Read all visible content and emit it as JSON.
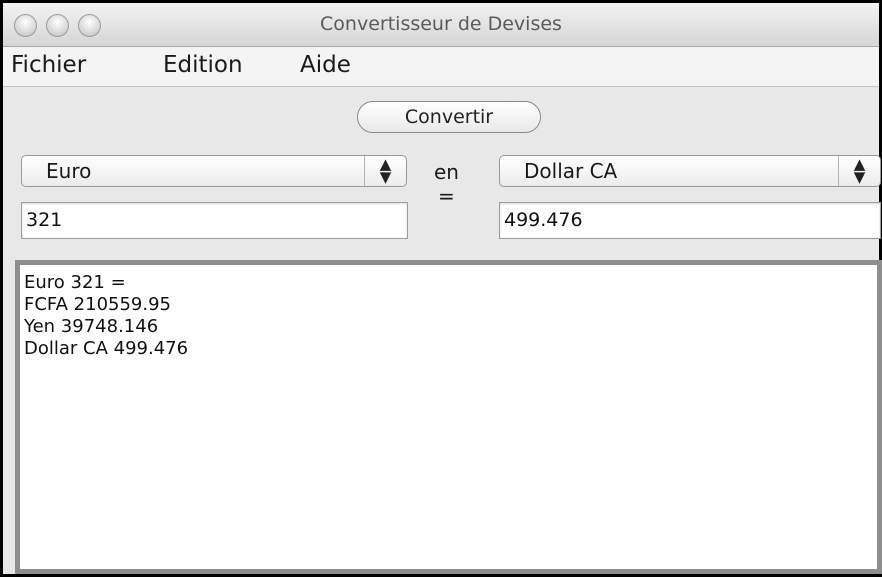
{
  "window": {
    "title": "Convertisseur de Devises"
  },
  "menu": {
    "items": [
      {
        "label": "Fichier"
      },
      {
        "label": "Edition"
      },
      {
        "label": "Aide"
      }
    ]
  },
  "toolbar": {
    "convert_label": "Convertir"
  },
  "from_currency": {
    "selected": "Euro",
    "amount": "321"
  },
  "to_currency": {
    "selected": "Dollar CA",
    "amount": "499.476"
  },
  "labels": {
    "en": "en",
    "equals": "="
  },
  "output": {
    "lines": [
      "Euro 321 =",
      "FCFA 210559.95",
      "Yen 39748.146",
      "Dollar CA 499.476"
    ]
  },
  "icons": {
    "select_arrows": "updown-arrows-icon"
  }
}
